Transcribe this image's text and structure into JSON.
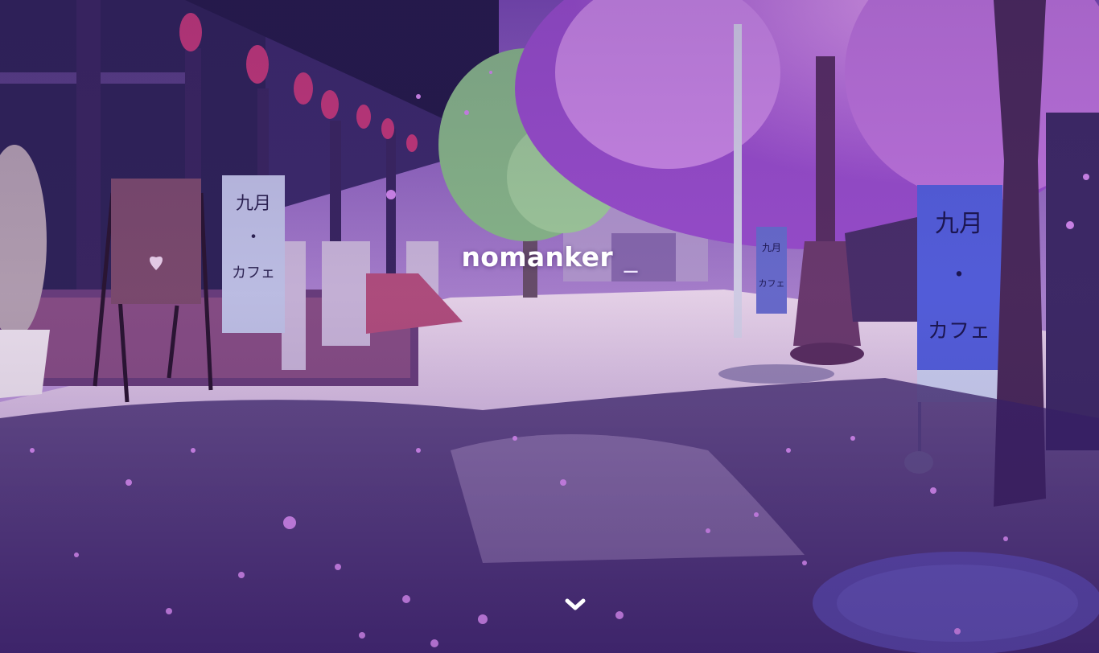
{
  "hero": {
    "title": "nomanker",
    "cursor": "_",
    "background_icon": "cherry-blossom-street-scene",
    "scroll_icon": "chevron-down-icon",
    "banner_left": {
      "line1": "九月",
      "line2": "・",
      "line3": "カフェ"
    },
    "banner_right": {
      "line1": "九月",
      "line2": "・",
      "line3": "カフェ"
    },
    "banner_far": {
      "line1": "九月",
      "line2": "カフェ"
    }
  },
  "colors": {
    "title_text": "#ffffff",
    "blossom": "#c86ee0",
    "ground": "#e9d6ee",
    "shadow": "#2a1650"
  }
}
